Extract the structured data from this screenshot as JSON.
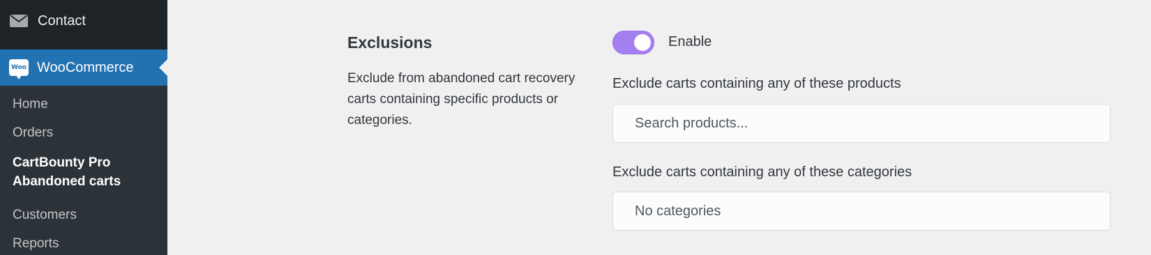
{
  "sidebar": {
    "contact_label": "Contact",
    "woocommerce_label": "WooCommerce",
    "woo_badge_text": "Woo",
    "items": [
      {
        "label": "Home"
      },
      {
        "label": "Orders"
      },
      {
        "label": "CartBounty Pro Abandoned carts"
      },
      {
        "label": "Customers"
      },
      {
        "label": "Reports"
      }
    ],
    "accent_color": "#2271b1"
  },
  "exclusions": {
    "title": "Exclusions",
    "description": "Exclude from abandoned cart recovery carts containing specific products or categories.",
    "toggle": {
      "state": "on",
      "label": "Enable",
      "color": "#a47ff0"
    },
    "products": {
      "label": "Exclude carts containing any of these products",
      "placeholder": "Search products..."
    },
    "categories": {
      "label": "Exclude carts containing any of these categories",
      "value": "No categories"
    }
  },
  "icons": [
    "envelope-icon",
    "woocommerce-icon"
  ]
}
